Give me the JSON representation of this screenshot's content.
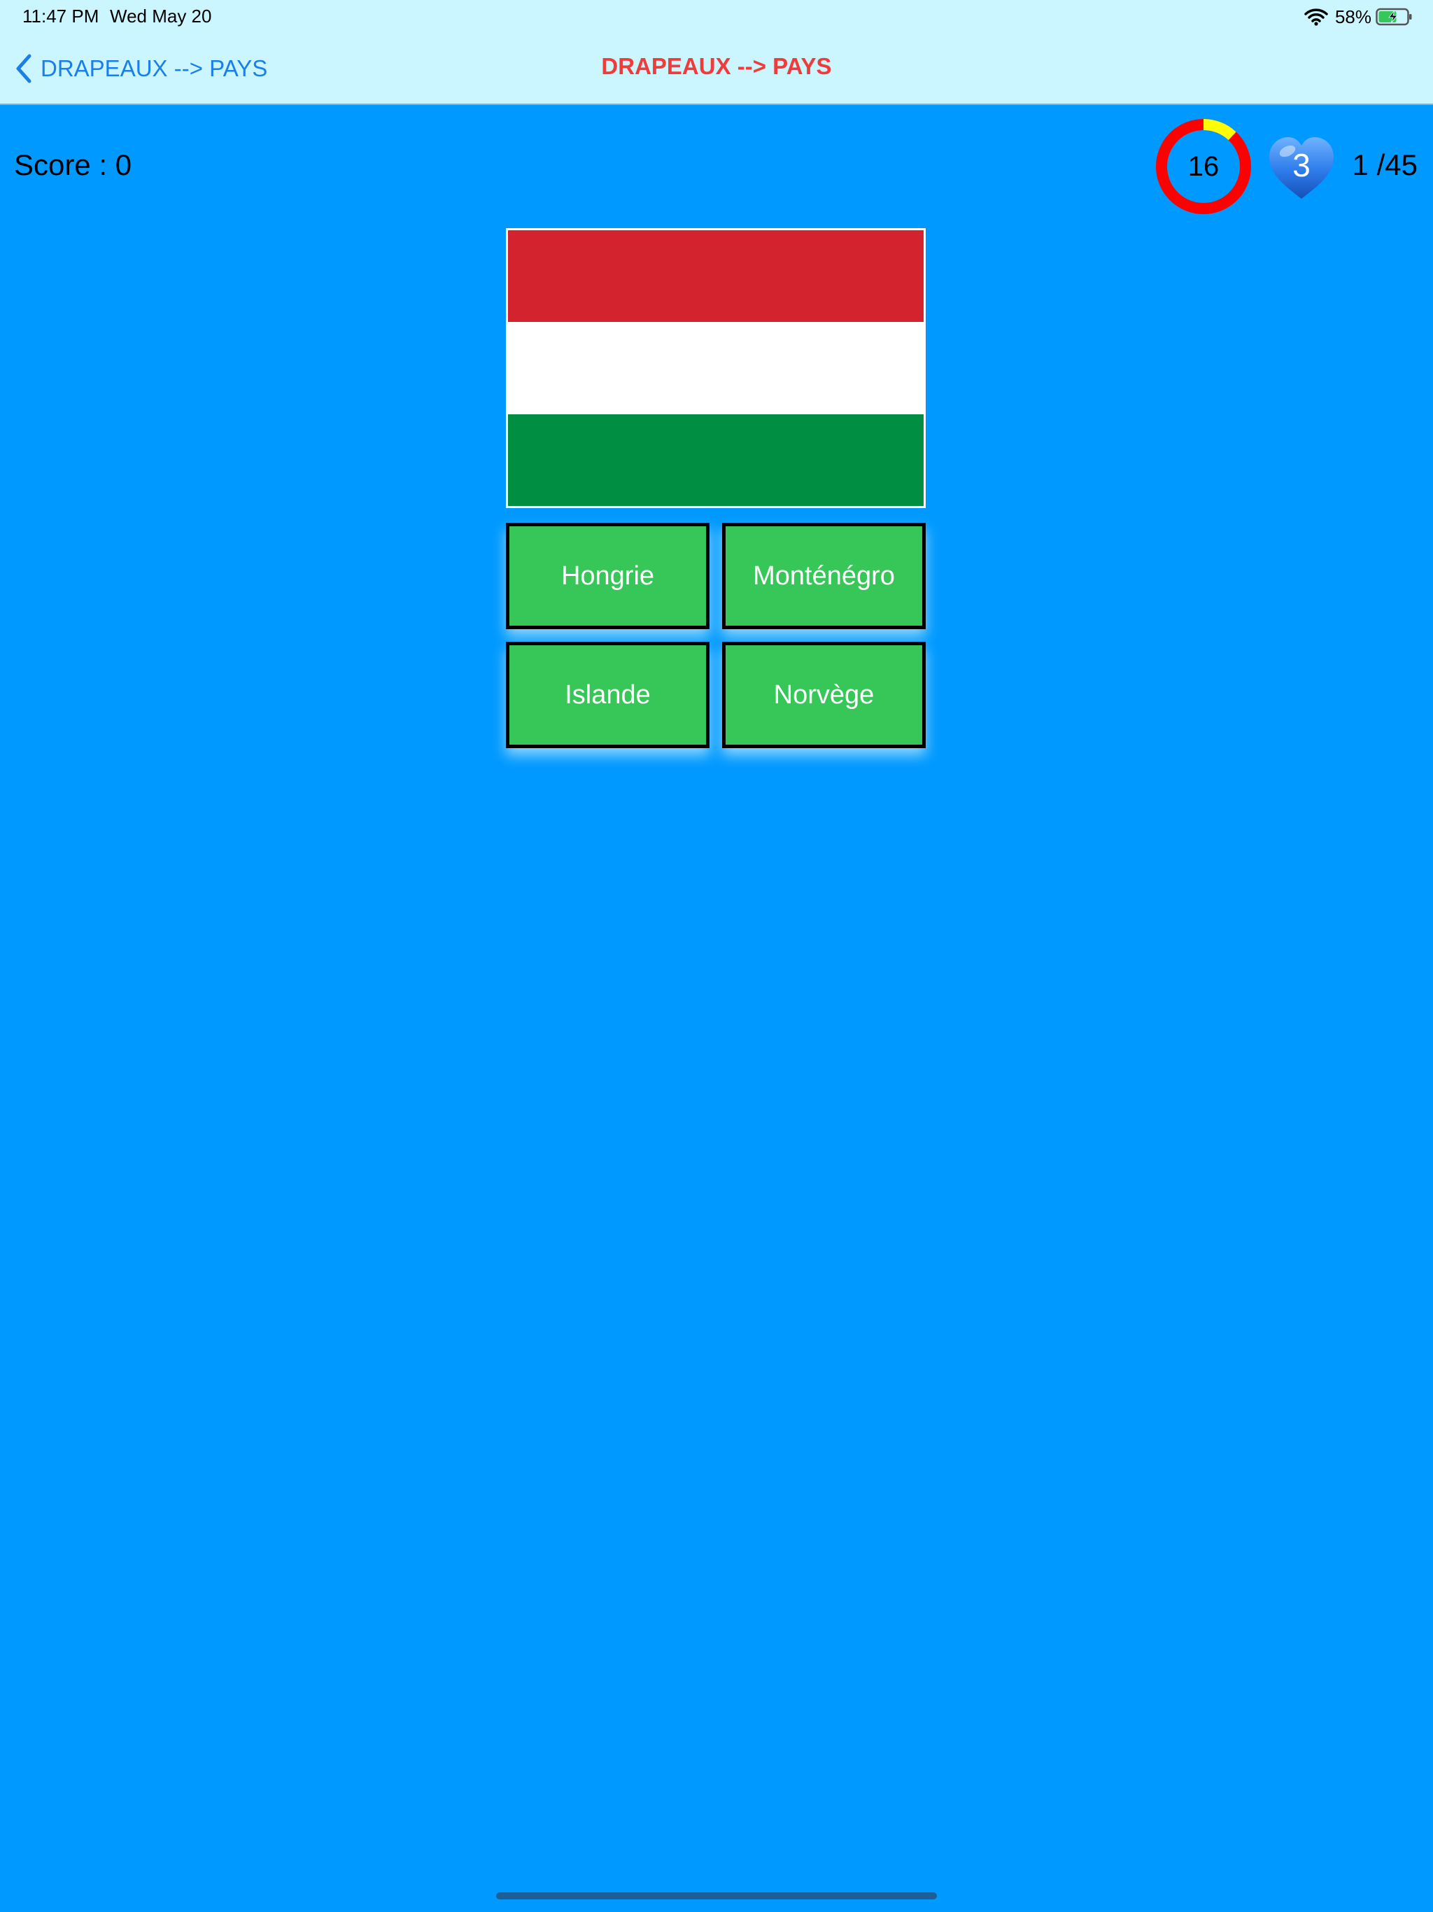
{
  "status_bar": {
    "time": "11:47 PM",
    "date": "Wed May 20",
    "battery_percent": "58%",
    "icons": [
      "wifi-icon",
      "battery-charging-icon"
    ]
  },
  "nav": {
    "back_label": "DRAPEAUX --> PAYS",
    "back_icon": "chevron-left-icon",
    "title": "DRAPEAUX --> PAYS"
  },
  "game": {
    "score_label": "Score : 0",
    "timer_value": "16",
    "timer_fraction_remaining": 0.12,
    "lives_value": "3",
    "lives_icon": "blue-heart-icon",
    "progress_label": "1 /45"
  },
  "flag": {
    "icon": "hungary-flag",
    "stripes": [
      "#D2232F",
      "#FFFFFF",
      "#008E43"
    ]
  },
  "answers": [
    {
      "label": "Hongrie"
    },
    {
      "label": "Monténégro"
    },
    {
      "label": "Islande"
    },
    {
      "label": "Norvège"
    }
  ],
  "colors": {
    "background": "#0099FF",
    "nav_background": "#CCF6FF",
    "nav_title": "#F03B3B",
    "back_link": "#1A7FE8",
    "answer_button": "#37C758",
    "timer_elapsed": "#FF0000",
    "timer_remaining": "#FFFF00"
  }
}
